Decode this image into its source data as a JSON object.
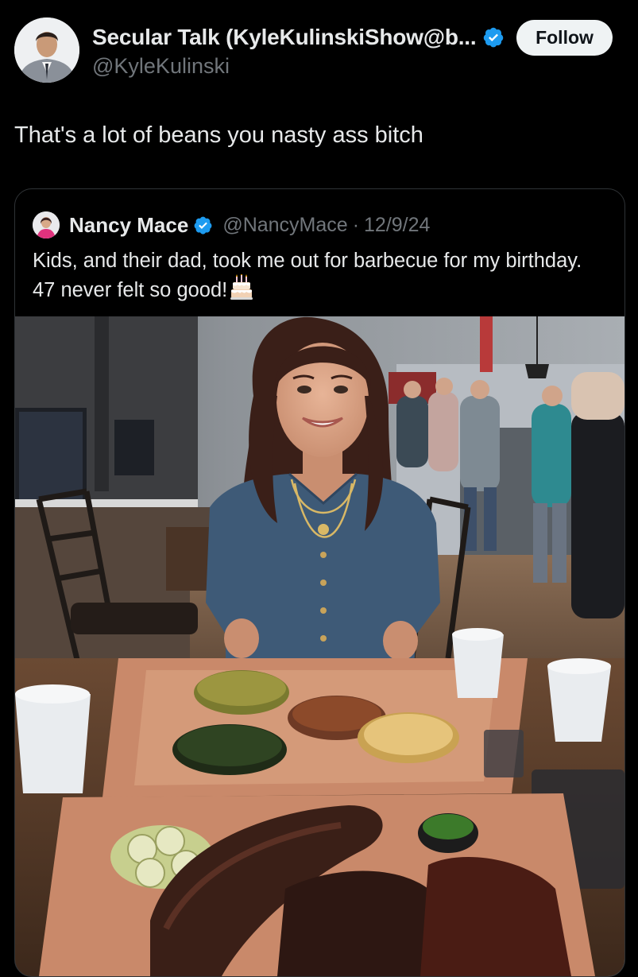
{
  "post": {
    "author": {
      "display_name": "Secular Talk (KyleKulinskiShow@b...",
      "handle": "@KyleKulinski",
      "verified": true,
      "avatar_icon": "profile-photo"
    },
    "follow_label": "Follow",
    "text": "That's a lot of beans you nasty ass bitch"
  },
  "quoted": {
    "author": {
      "display_name": "Nancy Mace",
      "handle": "@NancyMace",
      "separator": "·",
      "date": "12/9/24",
      "verified": true
    },
    "text": "Kids, and their dad, took me out for barbecue for my birthday. 47 never felt so good!",
    "emoji_icon": "birthday-cake-icon",
    "photo_icon": "barbecue-meal-photo"
  },
  "colors": {
    "background": "#000000",
    "text_primary": "#e7e9ea",
    "text_secondary": "#71767b",
    "verified_blue": "#1d9bf0",
    "follow_button_bg": "#eff3f4",
    "border": "#2f3336"
  }
}
